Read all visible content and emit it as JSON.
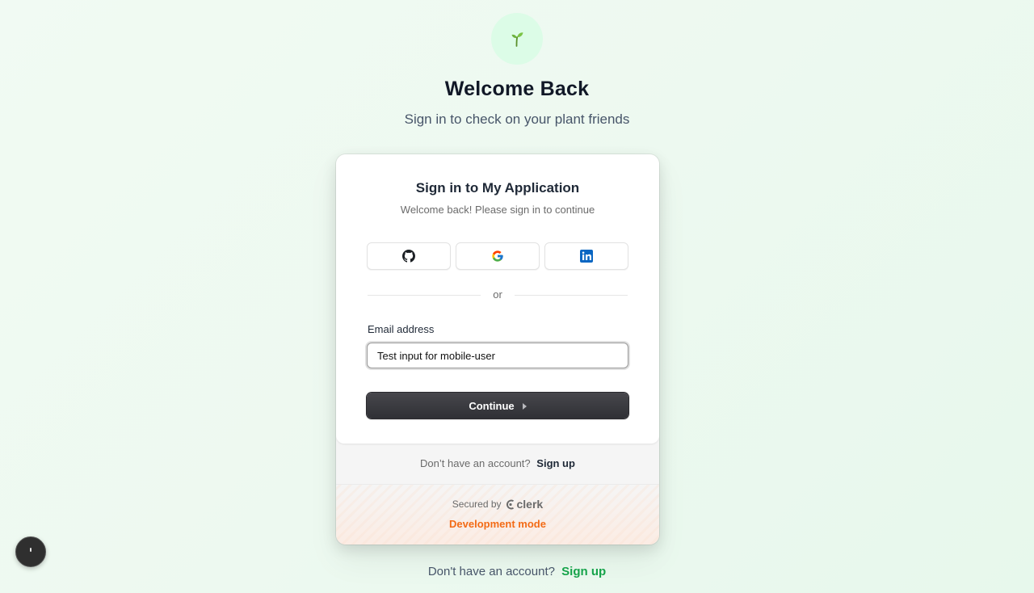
{
  "header": {
    "logo_icon": "seedling-icon",
    "title": "Welcome Back",
    "subtitle": "Sign in to check on your plant friends"
  },
  "sign_in_card": {
    "title": "Sign in to My Application",
    "subtitle": "Welcome back! Please sign in to continue",
    "social_providers": [
      {
        "name": "github-icon"
      },
      {
        "name": "google-icon"
      },
      {
        "name": "linkedin-icon"
      }
    ],
    "divider_text": "or",
    "email": {
      "label": "Email address",
      "value": "Test input for mobile-user"
    },
    "continue_label": "Continue",
    "footer_prompt": "Don’t have an account?",
    "footer_link": "Sign up",
    "secured_by": "Secured by",
    "brand": "clerk",
    "dev_mode": "Development mode"
  },
  "page_footer": {
    "prompt": "Don't have an account?",
    "link": "Sign up"
  },
  "colors": {
    "accent_green": "#16a34a",
    "dev_orange": "#f36b16",
    "button_dark": "#2f3035"
  }
}
